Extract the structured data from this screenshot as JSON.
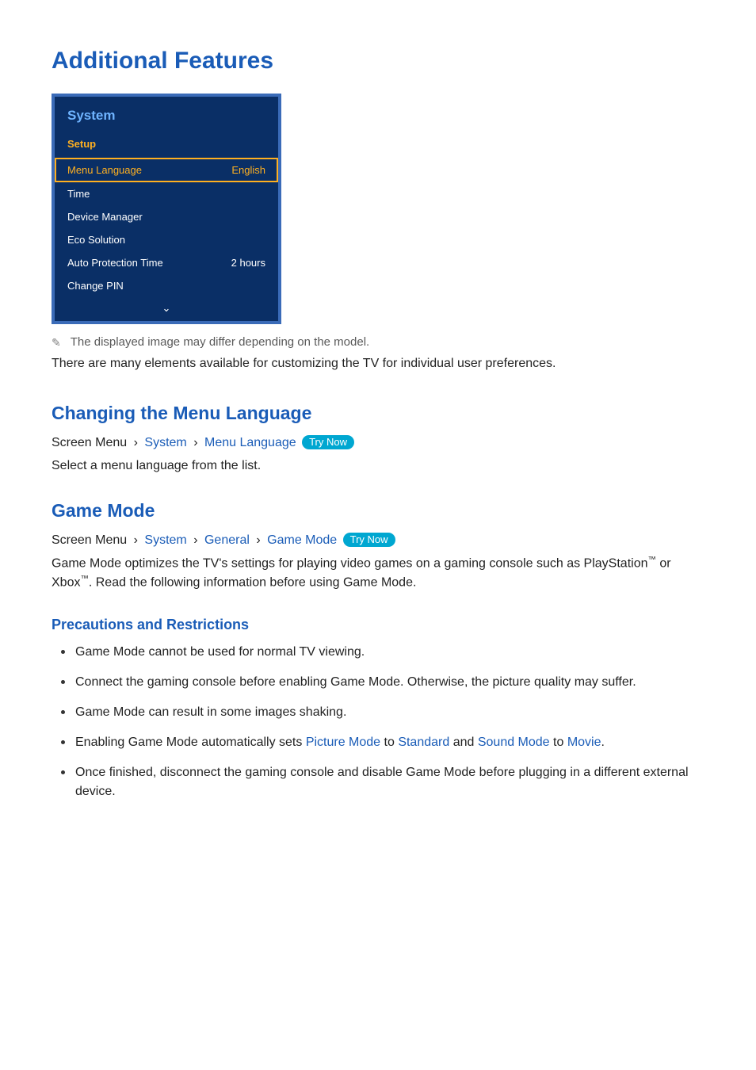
{
  "title": "Additional Features",
  "menu": {
    "header": "System",
    "section": "Setup",
    "rows": [
      {
        "label": "Menu Language",
        "value": "English",
        "selected": true
      },
      {
        "label": "Time",
        "value": ""
      },
      {
        "label": "Device Manager",
        "value": ""
      },
      {
        "label": "Eco Solution",
        "value": ""
      },
      {
        "label": "Auto Protection Time",
        "value": "2 hours"
      },
      {
        "label": "Change PIN",
        "value": ""
      }
    ],
    "chevron": "⌄"
  },
  "note": {
    "icon": "✎",
    "text": "The displayed image may differ depending on the model."
  },
  "intro": "There are many elements available for customizing the TV for individual user preferences.",
  "sections": {
    "changing_lang": {
      "heading": "Changing the Menu Language",
      "breadcrumb": {
        "prefix": "Screen Menu",
        "sep": "›",
        "parts": [
          "System",
          "Menu Language"
        ],
        "trynow": "Try Now"
      },
      "body": "Select a menu language from the list."
    },
    "game_mode": {
      "heading": "Game Mode",
      "breadcrumb": {
        "prefix": "Screen Menu",
        "sep": "›",
        "parts": [
          "System",
          "General",
          "Game Mode"
        ],
        "trynow": "Try Now"
      },
      "body_pre": "Game Mode optimizes the TV's settings for playing video games on a gaming console such as PlayStation",
      "tm": "™",
      "body_mid": " or Xbox",
      "body_post": ". Read the following information before using Game Mode."
    },
    "precautions": {
      "heading": "Precautions and Restrictions",
      "bullets": [
        {
          "text": "Game Mode cannot be used for normal TV viewing."
        },
        {
          "text": "Connect the gaming console before enabling Game Mode. Otherwise, the picture quality may suffer."
        },
        {
          "text": "Game Mode can result in some images shaking."
        },
        {
          "pre": "Enabling Game Mode automatically sets ",
          "l1": "Picture Mode",
          "mid1": " to ",
          "l2": "Standard",
          "mid2": " and ",
          "l3": "Sound Mode",
          "mid3": " to ",
          "l4": "Movie",
          "post": "."
        },
        {
          "text": "Once finished, disconnect the gaming console and disable Game Mode before plugging in a different external device."
        }
      ]
    }
  }
}
